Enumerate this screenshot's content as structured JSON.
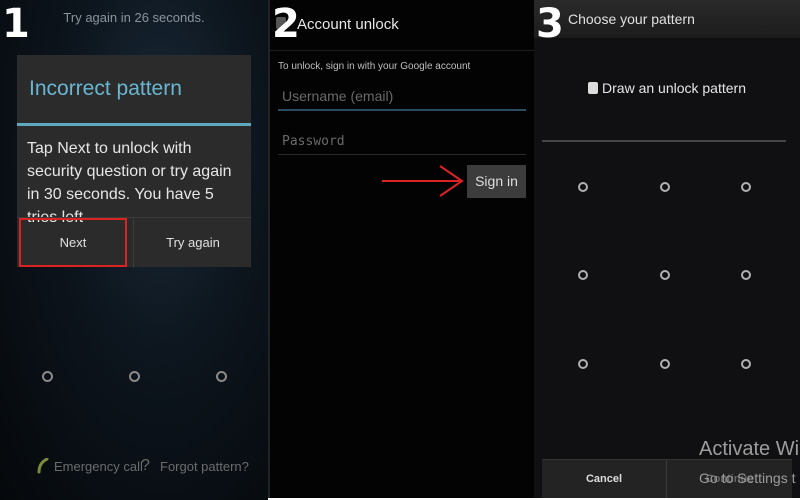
{
  "step_labels": [
    "1",
    "2",
    "3"
  ],
  "panel1": {
    "countdown": "Try again in 26 seconds.",
    "dialog_title": "Incorrect pattern",
    "dialog_message": "Tap Next to unlock with security question or try again in 30 seconds. You have 5 tries left",
    "next_label": "Next",
    "try_again_label": "Try again",
    "emergency_call": "Emergency call",
    "forgot_pattern": "Forgot pattern?",
    "help_icon": "?",
    "accent_color": "#69b6d2",
    "highlight_color": "#dd2222"
  },
  "panel2": {
    "title": "Account unlock",
    "instruction": "To unlock, sign in with your Google account",
    "username_placeholder": "Username (email)",
    "password_placeholder": "Password",
    "sign_in_label": "Sign in",
    "arrow_color": "#dd2222"
  },
  "panel3": {
    "title": "Choose your pattern",
    "instruction": "Draw an unlock pattern",
    "cancel_label": "Cancel",
    "continue_label": "Continue"
  },
  "watermark": {
    "line1": "Activate Wi",
    "line2": "Go to Settings t"
  }
}
